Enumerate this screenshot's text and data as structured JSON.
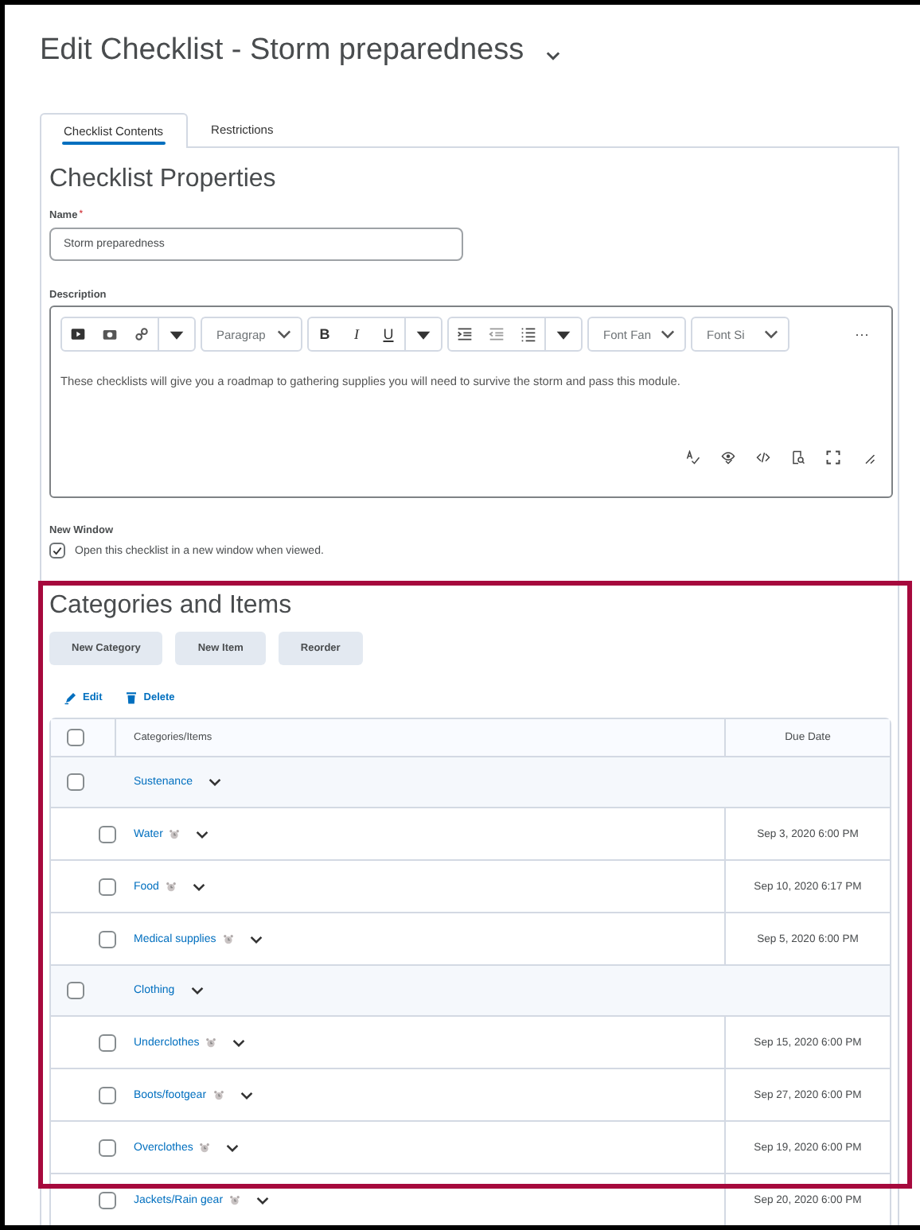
{
  "title": "Edit Checklist - Storm preparedness",
  "tabs": [
    {
      "label": "Checklist Contents",
      "selected": true
    },
    {
      "label": "Restrictions",
      "selected": false
    }
  ],
  "properties": {
    "heading": "Checklist Properties",
    "name_field": {
      "label": "Name",
      "required_mark": "*",
      "value": "Storm preparedness"
    },
    "description": {
      "label": "Description",
      "dropdowns": [
        "Paragrap",
        "Font Fan",
        "Font Si"
      ],
      "format_buttons": [
        "B",
        "I",
        "U"
      ],
      "more": "···",
      "text": "These checklists will give you a roadmap to gathering supplies you will need to survive the storm and pass this module."
    },
    "new_window": {
      "label": "New Window",
      "checked": true,
      "option": "Open this checklist in a new window when viewed."
    }
  },
  "categories": {
    "heading": "Categories and Items",
    "buttons": [
      "New Category",
      "New Item",
      "Reorder"
    ],
    "actions": [
      "Edit",
      "Delete"
    ],
    "columns": [
      "Categories/Items",
      "Due Date"
    ],
    "select_all_checked": false,
    "groups": [
      {
        "name": "Sustenance",
        "checked": false,
        "children": [
          {
            "name": "Water",
            "due": "Sep 3, 2020 6:00 PM",
            "checked": false
          },
          {
            "name": "Food",
            "due": "Sep 10, 2020 6:17 PM",
            "checked": false
          },
          {
            "name": "Medical supplies",
            "due": "Sep 5, 2020 6:00 PM",
            "checked": false
          }
        ]
      },
      {
        "name": "Clothing",
        "checked": false,
        "children": [
          {
            "name": "Underclothes",
            "due": "Sep 15, 2020 6:00 PM",
            "checked": false
          },
          {
            "name": "Boots/footgear",
            "due": "Sep 27, 2020 6:00 PM",
            "checked": false
          },
          {
            "name": "Overclothes",
            "due": "Sep 19, 2020 6:00 PM",
            "checked": false
          },
          {
            "name": "Jackets/Rain gear",
            "due": "Sep 20, 2020 6:00 PM",
            "checked": false
          }
        ]
      }
    ]
  }
}
